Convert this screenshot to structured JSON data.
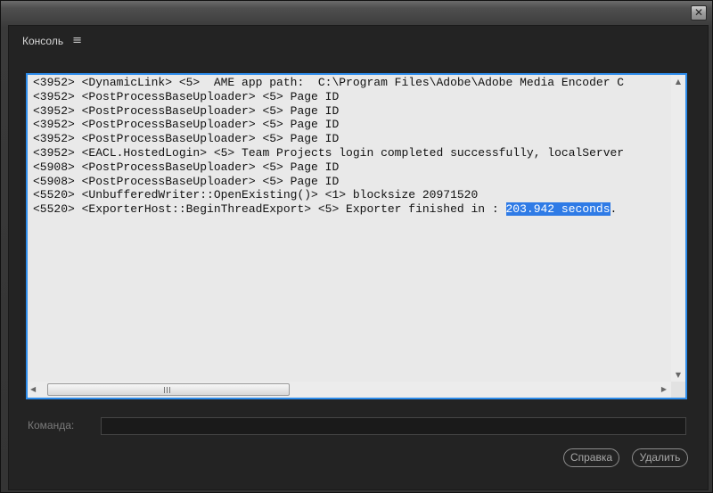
{
  "window": {
    "close_glyph": "✕"
  },
  "panel": {
    "title": "Консоль",
    "menu_icon": "≡"
  },
  "console": {
    "lines": [
      "<3952> <DynamicLink> <5>  AME app path:  C:\\Program Files\\Adobe\\Adobe Media Encoder C",
      "<3952> <PostProcessBaseUploader> <5> Page ID",
      "<3952> <PostProcessBaseUploader> <5> Page ID",
      "<3952> <PostProcessBaseUploader> <5> Page ID",
      "<3952> <PostProcessBaseUploader> <5> Page ID",
      "<3952> <EACL.HostedLogin> <5> Team Projects login completed successfully, localServer",
      "<5908> <PostProcessBaseUploader> <5> Page ID",
      "<5908> <PostProcessBaseUploader> <5> Page ID",
      "<5520> <UnbufferedWriter::OpenExisting()> <1> blocksize 20971520"
    ],
    "last_line": {
      "prefix": "<5520> <ExporterHost::BeginThreadExport> <5> Exporter finished in : ",
      "selected": "203.942 seconds",
      "suffix": "."
    },
    "scroll": {
      "up": "▲",
      "down": "▼",
      "left": "◀",
      "right": "▶"
    }
  },
  "command": {
    "label": "Команда:",
    "value": "",
    "placeholder": ""
  },
  "buttons": {
    "help": "Справка",
    "delete": "Удалить"
  },
  "colors": {
    "selection": "#2f7be6",
    "focus_border": "#2d8ceb"
  }
}
